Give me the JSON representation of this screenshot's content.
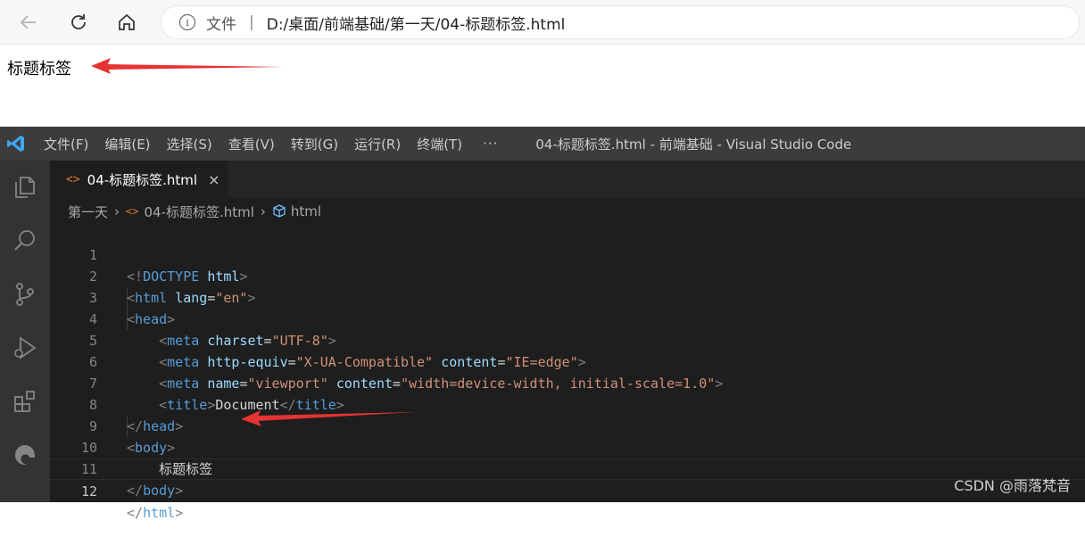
{
  "browser": {
    "address_scheme": "文件",
    "address_sep": "|",
    "address_path": "D:/桌面/前端基础/第一天/04-标题标签.html",
    "page_text": "标题标签"
  },
  "vscode": {
    "menu": [
      "文件(F)",
      "编辑(E)",
      "选择(S)",
      "查看(V)",
      "转到(G)",
      "运行(R)",
      "终端(T)"
    ],
    "menu_more": "···",
    "window_title": "04-标题标签.html - 前端基础 - Visual Studio Code",
    "tab": {
      "label": "04-标题标签.html",
      "close": "×",
      "file_icon": "<>"
    },
    "breadcrumb": {
      "folder": "第一天",
      "file": "04-标题标签.html",
      "symbol": "html"
    },
    "line_numbers": [
      "1",
      "2",
      "3",
      "4",
      "5",
      "6",
      "7",
      "8",
      "9",
      "10",
      "11",
      "12"
    ],
    "code_text": {
      "doctype_open": "<!",
      "doctype_kw": "DOCTYPE",
      "doctype_html": "html",
      "doctype_close": ">",
      "meta_charset_value": "\"UTF-8\"",
      "meta_http_equiv_value": "\"X-UA-Compatible\"",
      "meta_http_content_value": "\"IE=edge\"",
      "meta_name_value": "\"viewport\"",
      "meta_viewport_content_value": "\"width=device-width, initial-scale=1.0\"",
      "title_text": "Document",
      "body_text": "标题标签",
      "lang_value": "\"en\""
    },
    "watermark": "CSDN @雨落梵音"
  },
  "colors": {
    "arrow": "#e63333",
    "vscode_blue": "#3da7f0"
  }
}
